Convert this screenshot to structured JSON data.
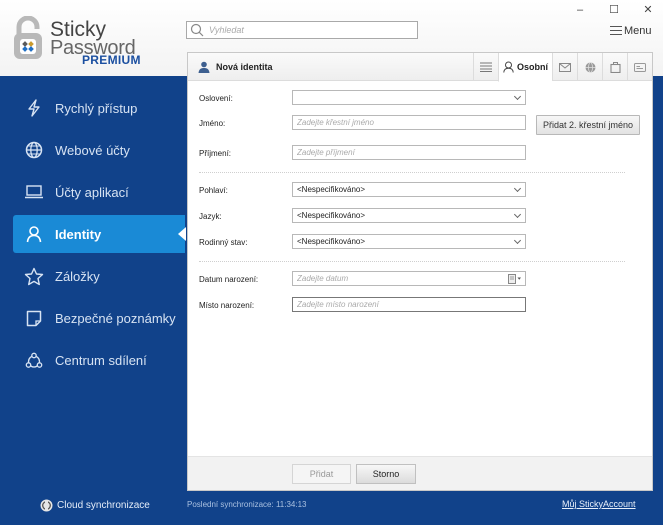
{
  "app": {
    "logo": {
      "line1": "Sticky",
      "line2": "Password",
      "edition": "PREMIUM"
    },
    "window_controls": {
      "minimize": "–",
      "maximize": "☐",
      "close": "✕"
    },
    "menu_label": "Menu"
  },
  "search": {
    "placeholder": "Vyhledat",
    "value": ""
  },
  "sidebar": {
    "items": [
      {
        "label": "Rychlý přístup",
        "icon": "lightning-icon",
        "active": false
      },
      {
        "label": "Webové účty",
        "icon": "globe-icon",
        "active": false
      },
      {
        "label": "Účty aplikací",
        "icon": "laptop-icon",
        "active": false
      },
      {
        "label": "Identity",
        "icon": "person-icon",
        "active": true
      },
      {
        "label": "Záložky",
        "icon": "star-icon",
        "active": false
      },
      {
        "label": "Bezpečné poznámky",
        "icon": "note-icon",
        "active": false
      },
      {
        "label": "Centrum sdílení",
        "icon": "share-icon",
        "active": false
      }
    ],
    "cloud_sync_label": "Cloud synchronizace"
  },
  "panel": {
    "title": "Nová identita",
    "tabs": [
      {
        "name": "list",
        "icon": "list-icon",
        "label": ""
      },
      {
        "name": "personal",
        "icon": "person-icon",
        "label": "Osobní",
        "active": true
      },
      {
        "name": "email",
        "icon": "envelope-icon",
        "label": ""
      },
      {
        "name": "web",
        "icon": "globe-icon",
        "label": ""
      },
      {
        "name": "work",
        "icon": "briefcase-icon",
        "label": ""
      },
      {
        "name": "card",
        "icon": "id-card-icon",
        "label": ""
      }
    ],
    "form": {
      "salutation": {
        "label": "Oslovení:",
        "value": ""
      },
      "first_name": {
        "label": "Jméno:",
        "placeholder": "Zadejte křestní jméno",
        "value": ""
      },
      "add_second_name_button": "Přidat 2. křestní jméno",
      "last_name": {
        "label": "Příjmení:",
        "placeholder": "Zadejte příjmení",
        "value": ""
      },
      "gender": {
        "label": "Pohlaví:",
        "value": "<Nespecifikováno>"
      },
      "language": {
        "label": "Jazyk:",
        "value": "<Nespecifikováno>"
      },
      "marital_status": {
        "label": "Rodinný stav:",
        "value": "<Nespecifikováno>"
      },
      "birth_date": {
        "label": "Datum narození:",
        "placeholder": "Zadejte datum",
        "value": ""
      },
      "birth_place": {
        "label": "Místo narození:",
        "placeholder": "Zadejte místo narození",
        "value": ""
      }
    },
    "buttons": {
      "add": "Přidat",
      "cancel": "Storno"
    }
  },
  "status": {
    "last_sync": "Poslední synchronizace: 11:34:13",
    "my_account_link": "Můj StickyAccount"
  },
  "colors": {
    "sidebar_bg": "#11428a",
    "active_item": "#1a8ad6",
    "brand_blue": "#1b4fa0"
  }
}
